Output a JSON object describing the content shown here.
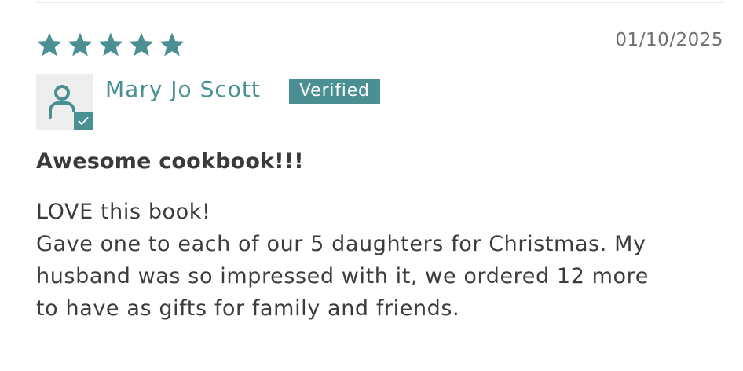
{
  "review": {
    "rating": 5,
    "rating_max": 5,
    "date": "01/10/2025",
    "author": "Mary Jo Scott",
    "badge": "Verified",
    "title": "Awesome cookbook!!!",
    "body_lines": [
      "LOVE this book!",
      "Gave one to each of our 5 daughters for Christmas. My",
      "husband was so impressed with it, we ordered 12 more",
      "to have as gifts for family and friends."
    ]
  },
  "icons": {
    "star": "star-icon",
    "avatar": "user-icon",
    "avatar_badge": "checkmark-icon"
  },
  "colors": {
    "accent": "#4a9093",
    "text": "#3c3c3c",
    "date": "#6f6f6f",
    "avatar_bg": "#eeeeee",
    "divider": "#ececec"
  }
}
